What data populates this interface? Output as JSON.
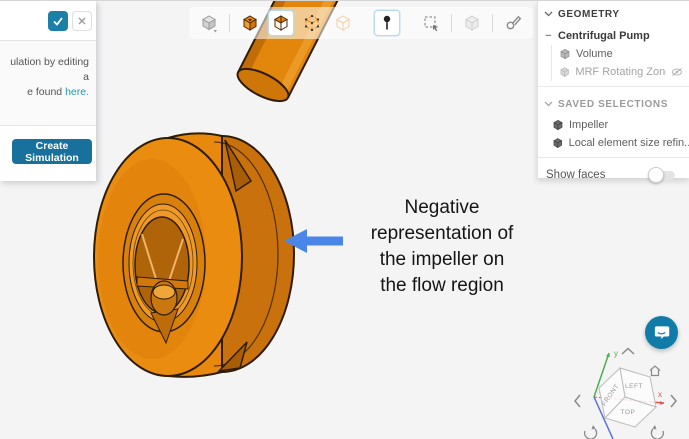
{
  "dialog": {
    "body_text_line1": "ulation by editing a",
    "body_text_line2": "e found",
    "body_link": "here.",
    "create_button_label": "Create Simulation"
  },
  "toolbar": {
    "icon_names": [
      "render-mode-cube",
      "solid-view-cube",
      "transparent-view-cube",
      "vertices-view-cube",
      "ghost-view-cube",
      "probe-pin",
      "box-select",
      "disabled-cube",
      "measure-tool"
    ]
  },
  "geometry_panel": {
    "geometry_header": "GEOMETRY",
    "root_item_label": "Centrifugal Pump",
    "children": [
      "Volume",
      "MRF Rotating Zone"
    ],
    "saved_selections_header": "SAVED SELECTIONS",
    "saved_selections": [
      "Impeller",
      "Local element size refin..."
    ],
    "show_faces_label": "Show faces"
  },
  "annotation": {
    "lines": [
      "Negative",
      "representation of",
      "the impeller on",
      "the flow region"
    ]
  },
  "view_cube": {
    "face_top": "LEFT",
    "face_left": "FRONT",
    "face_bottom": "TOP",
    "axis_x": "x",
    "axis_y": "y"
  },
  "colors": {
    "primary_button": "#17719c",
    "impeller_orange": "#e8890e",
    "annotation_arrow": "#4a86e8",
    "chat_bubble": "#0f7ba6",
    "link": "#1d9ab0"
  }
}
